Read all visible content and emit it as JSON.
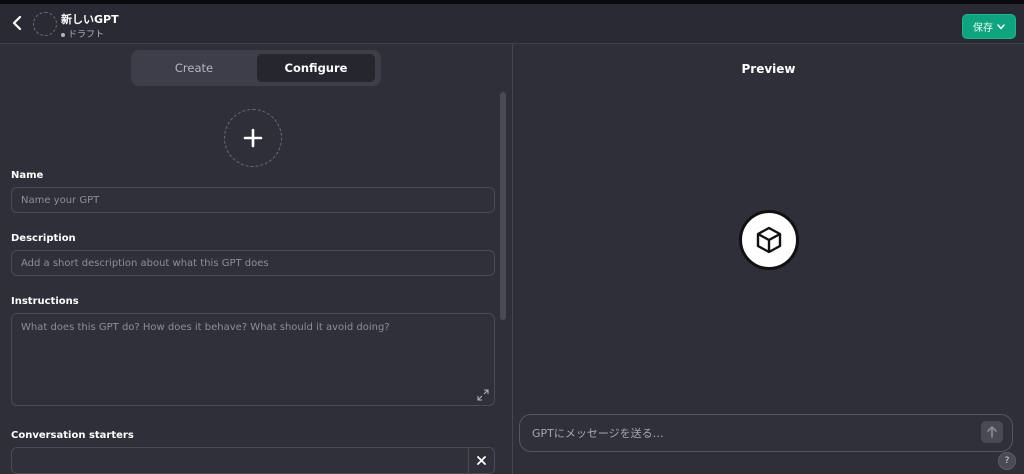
{
  "header": {
    "gpt_name": "新しいGPT",
    "status": "ドラフト",
    "save_label": "保存"
  },
  "tabs": [
    {
      "label": "Create"
    },
    {
      "label": "Configure"
    }
  ],
  "form": {
    "name_label": "Name",
    "name_placeholder": "Name your GPT",
    "description_label": "Description",
    "description_placeholder": "Add a short description about what this GPT does",
    "instructions_label": "Instructions",
    "instructions_placeholder": "What does this GPT do? How does it behave? What should it avoid doing?",
    "starters_label": "Conversation starters",
    "starter_value": ""
  },
  "preview": {
    "title": "Preview",
    "message_placeholder": "GPTにメッセージを送る…",
    "help_label": "?"
  },
  "icons": {
    "back": "chevron-left-icon",
    "save_dropdown": "chevron-down-icon",
    "add_image": "plus-icon",
    "expand": "expand-icon",
    "remove": "close-icon",
    "logo": "cube-icon",
    "send": "arrow-up-icon"
  },
  "colors": {
    "background": "#2f2f3a",
    "accent": "#10a37f"
  }
}
